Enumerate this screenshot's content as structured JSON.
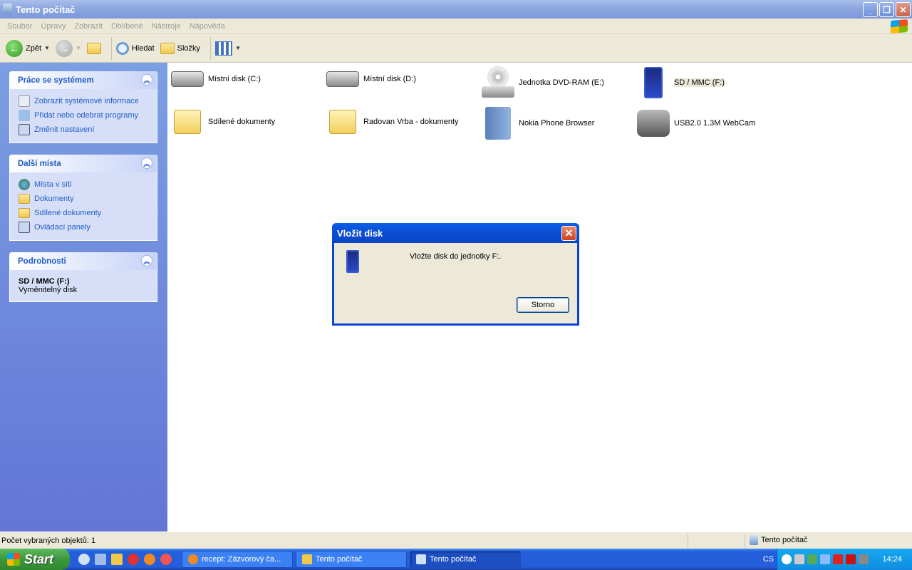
{
  "window": {
    "title": "Tento počítač"
  },
  "menu": [
    "Soubor",
    "Úpravy",
    "Zobrazit",
    "Oblíbené",
    "Nástroje",
    "Nápověda"
  ],
  "toolbar": {
    "back": "Zpět",
    "search": "Hledat",
    "folders": "Složky"
  },
  "panels": [
    {
      "title": "Práce se systémem",
      "links": [
        "Zobrazit systémové informace",
        "Přidat nebo odebrat programy",
        "Změnit nastavení"
      ]
    },
    {
      "title": "Další místa",
      "links": [
        "Místa v síti",
        "Dokumenty",
        "Sdílené dokumenty",
        "Ovládací panely"
      ]
    },
    {
      "title": "Podrobnosti",
      "name": "SD / MMC (F:)",
      "type": "Vyměnitelný disk"
    }
  ],
  "items": [
    "Místní disk (C:)",
    "Místní disk (D:)",
    "Jednotka DVD-RAM (E:)",
    "SD / MMC (F:)",
    "Sdílené dokumenty",
    "Radovan Vrba - dokumenty",
    "Nokia Phone Browser",
    "USB2.0 1.3M WebCam"
  ],
  "status": {
    "left": "Počet vybraných objektů: 1",
    "right": "Tento počítač"
  },
  "dialog": {
    "title": "Vložit disk",
    "message": "Vložte disk do jednotky F:.",
    "cancel": "Storno"
  },
  "taskbar": {
    "start": "Start",
    "tasks": [
      "recept: Zázvorový ča...",
      "Tento počítač",
      "Tento počítač"
    ],
    "lang": "CS",
    "clock": "14:24"
  }
}
